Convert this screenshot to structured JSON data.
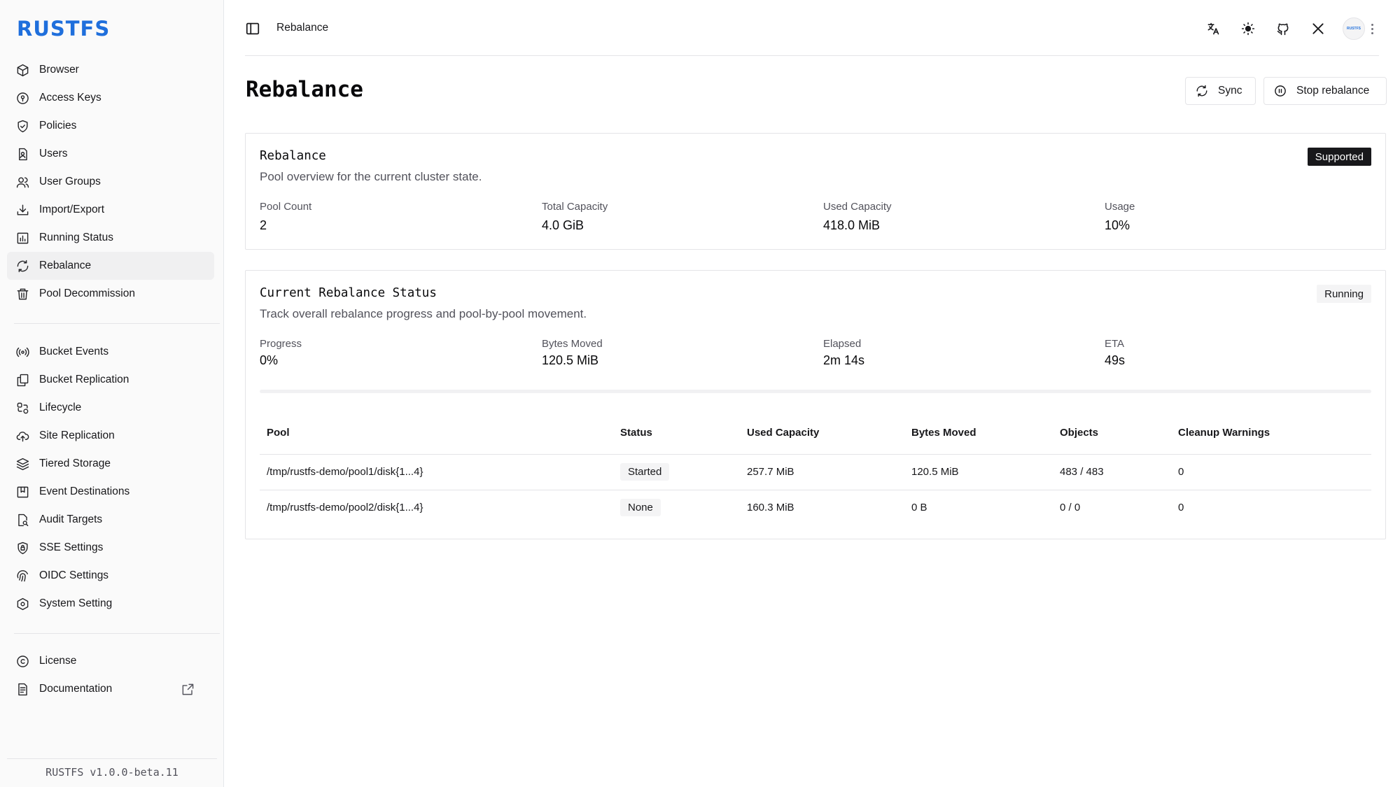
{
  "brand": "RUSTFS",
  "version": "RUSTFS  v1.0.0-beta.11",
  "sidebar": {
    "group1": [
      {
        "label": "Browser",
        "icon": "box-icon"
      },
      {
        "label": "Access Keys",
        "icon": "key-circle-icon"
      },
      {
        "label": "Policies",
        "icon": "shield-check-icon"
      },
      {
        "label": "Users",
        "icon": "user-file-icon"
      },
      {
        "label": "User Groups",
        "icon": "users-icon"
      },
      {
        "label": "Import/Export",
        "icon": "download-icon"
      },
      {
        "label": "Running Status",
        "icon": "bar-chart-icon"
      },
      {
        "label": "Rebalance",
        "icon": "refresh-icon",
        "active": true
      },
      {
        "label": "Pool Decommission",
        "icon": "trash-icon"
      }
    ],
    "group2": [
      {
        "label": "Bucket Events",
        "icon": "radio-icon"
      },
      {
        "label": "Bucket Replication",
        "icon": "copy-icon"
      },
      {
        "label": "Lifecycle",
        "icon": "cycle-icon"
      },
      {
        "label": "Site Replication",
        "icon": "cloud-upload-icon"
      },
      {
        "label": "Tiered Storage",
        "icon": "layers-icon"
      },
      {
        "label": "Event Destinations",
        "icon": "bookmark-icon"
      },
      {
        "label": "Audit Targets",
        "icon": "file-search-icon"
      },
      {
        "label": "SSE Settings",
        "icon": "shield-lock-icon"
      },
      {
        "label": "OIDC Settings",
        "icon": "fingerprint-icon"
      },
      {
        "label": "System Setting",
        "icon": "gear-hex-icon"
      }
    ],
    "group3": [
      {
        "label": "License",
        "icon": "copyright-icon"
      },
      {
        "label": "Documentation",
        "icon": "document-icon",
        "external": true
      }
    ]
  },
  "topbar": {
    "breadcrumb": "Rebalance",
    "avatar_text": "RUSTFS"
  },
  "page": {
    "title": "Rebalance",
    "sync_label": "Sync",
    "stop_label": "Stop rebalance"
  },
  "overview": {
    "title": "Rebalance",
    "subtitle": "Pool overview for the current cluster state.",
    "badge": "Supported",
    "stats": [
      {
        "label": "Pool Count",
        "value": "2"
      },
      {
        "label": "Total Capacity",
        "value": "4.0 GiB"
      },
      {
        "label": "Used Capacity",
        "value": "418.0 MiB"
      },
      {
        "label": "Usage",
        "value": "10%"
      }
    ]
  },
  "status": {
    "title": "Current Rebalance Status",
    "subtitle": "Track overall rebalance progress and pool-by-pool movement.",
    "badge": "Running",
    "progress_fraction": 0,
    "stats": [
      {
        "label": "Progress",
        "value": "0%"
      },
      {
        "label": "Bytes Moved",
        "value": "120.5 MiB"
      },
      {
        "label": "Elapsed",
        "value": "2m 14s"
      },
      {
        "label": "ETA",
        "value": "49s"
      }
    ],
    "table": {
      "columns": [
        "Pool",
        "Status",
        "Used Capacity",
        "Bytes Moved",
        "Objects",
        "Cleanup Warnings"
      ],
      "rows": [
        [
          "/tmp/rustfs-demo/pool1/disk{1...4}",
          "Started",
          "257.7 MiB",
          "120.5 MiB",
          "483 / 483",
          "0"
        ],
        [
          "/tmp/rustfs-demo/pool2/disk{1...4}",
          "None",
          "160.3 MiB",
          "0 B",
          "0 / 0",
          "0"
        ]
      ]
    }
  }
}
